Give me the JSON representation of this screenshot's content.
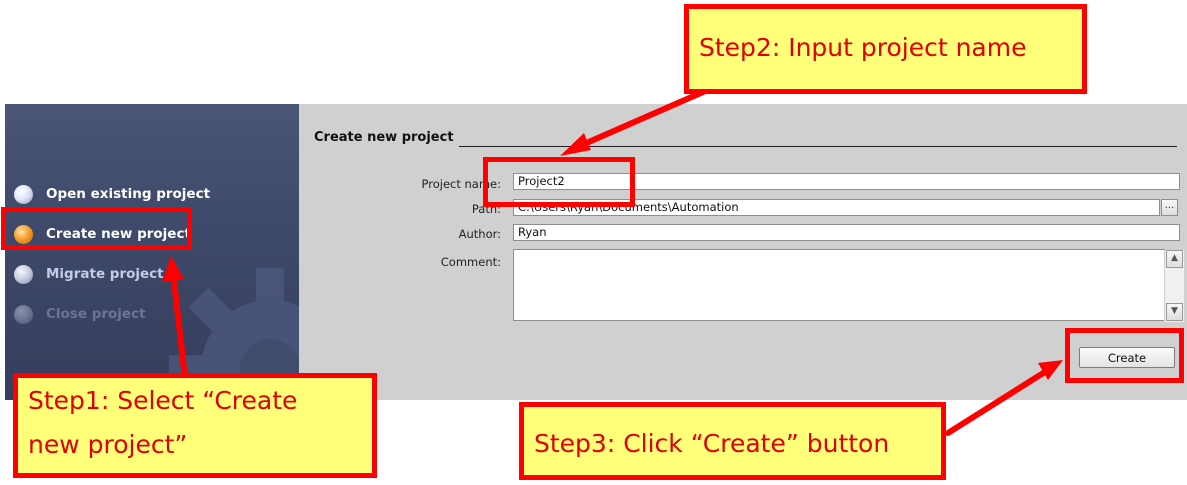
{
  "navigation": {
    "items": [
      {
        "label": "Open existing project",
        "state": "normal"
      },
      {
        "label": "Create new project",
        "state": "selected"
      },
      {
        "label": "Migrate project",
        "state": "normal"
      },
      {
        "label": "Close project",
        "state": "disabled"
      }
    ]
  },
  "form": {
    "section_title": "Create new project",
    "fields": {
      "project_name": {
        "label": "Project name:",
        "value": "Project2"
      },
      "path": {
        "label": "Path:",
        "value": "C:\\Users\\Ryan\\Documents\\Automation",
        "browse_label": "..."
      },
      "author": {
        "label": "Author:",
        "value": "Ryan"
      },
      "comment": {
        "label": "Comment:",
        "value": ""
      }
    },
    "create_button_label": "Create"
  },
  "annotations": {
    "step1_line1": "Step1: Select “Create",
    "step1_line2": "new project”",
    "step2": "Step2: Input project name",
    "step3": "Step3: Click “Create” button"
  },
  "colors": {
    "nav_background": "#3e4868",
    "form_background": "#d0d0d0",
    "annotation_fill": "#ffff7a",
    "annotation_border": "#ff0000",
    "annotation_text": "#e00000",
    "selected_bullet": "#f6a02a"
  }
}
